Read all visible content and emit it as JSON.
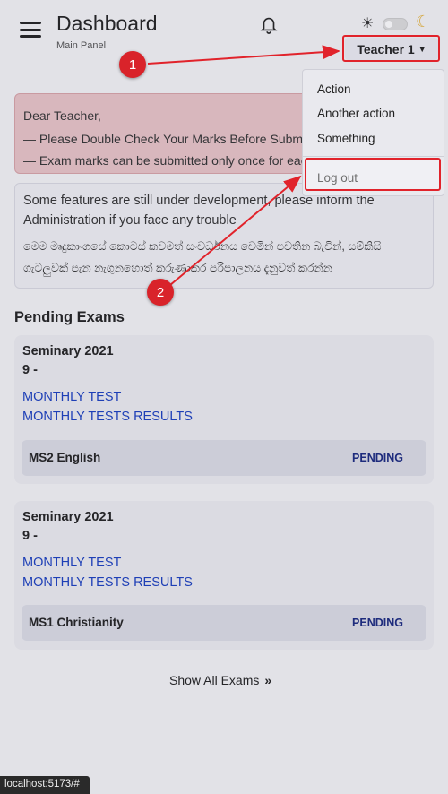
{
  "header": {
    "title": "Dashboard",
    "subtitle": "Main Panel",
    "user_menu_label": "Teacher 1"
  },
  "user_dropdown": {
    "items": [
      "Action",
      "Another action",
      "Something"
    ],
    "logout_label": "Log out"
  },
  "alert": {
    "greeting": "Dear Teacher,",
    "line1": "— Please Double Check Your Marks Before Submitting",
    "line2": "— Exam marks can be submitted only once for each exam"
  },
  "info": {
    "english": "Some features are still under development, please inform the Administration if you face any trouble",
    "sinhala": "මෙම මෘදුකාංගයේ කොටස් කවමත් සංවර්ධනය වෙමින් පවතින බැවින්, යම්කිසි ගැටලුවක් පැන නැගුනහොත් කරුණාකර පරිපාලනය දැනුවත් කරන්න"
  },
  "pending": {
    "title": "Pending Exams",
    "exams": [
      {
        "name": "Seminary 2021",
        "grade": "9 -",
        "link1": "MONTHLY TEST",
        "link2": "MONTHLY TESTS RESULTS",
        "subject": "MS2 English",
        "status": "PENDING"
      },
      {
        "name": "Seminary 2021",
        "grade": "9 -",
        "link1": "MONTHLY TEST",
        "link2": "MONTHLY TESTS RESULTS",
        "subject": "MS1 Christianity",
        "status": "PENDING"
      }
    ],
    "show_all_label": "Show All Exams"
  },
  "annotations": {
    "badge1": "1",
    "badge2": "2",
    "color": "#e1232b"
  },
  "statusbar": {
    "url": "localhost:5173/#"
  }
}
